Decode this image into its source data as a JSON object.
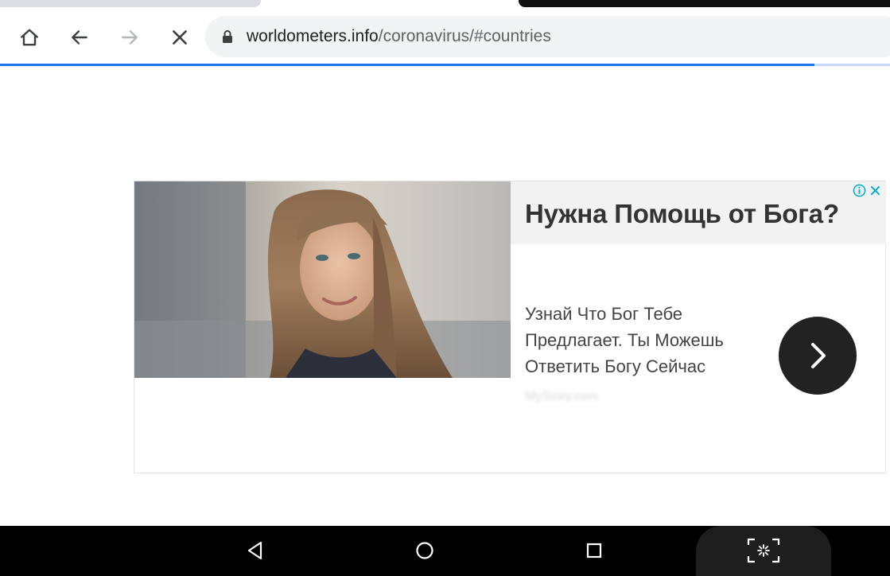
{
  "browser": {
    "url_host": "worldometers.info",
    "url_path": "/coronavirus/#countries",
    "page_load_progress": 0.915
  },
  "ad": {
    "headline": "Нужна Помощь от Бога?",
    "body_lines": [
      "Узнай Что Бог Тебе",
      "Предлагает. Ты Можешь",
      "Ответить Богу Сейчас"
    ],
    "source_label": "MyStory.com"
  },
  "icons": {
    "home": "home-icon",
    "back": "arrow-left-icon",
    "forward": "arrow-right-icon",
    "stop": "close-icon",
    "lock": "lock-icon",
    "ad_info": "info-icon",
    "ad_close": "close-icon",
    "ad_next": "chevron-right-icon",
    "nav_back": "triangle-back-icon",
    "nav_home": "circle-home-icon",
    "nav_recents": "square-recents-icon",
    "screenshot": "screenshot-icon"
  },
  "colors": {
    "accent": "#1a73e8",
    "omnibox_bg": "#f1f3f4",
    "headline_bg": "#f2f2f2",
    "ad_button": "#222222",
    "navbar": "#000000"
  }
}
